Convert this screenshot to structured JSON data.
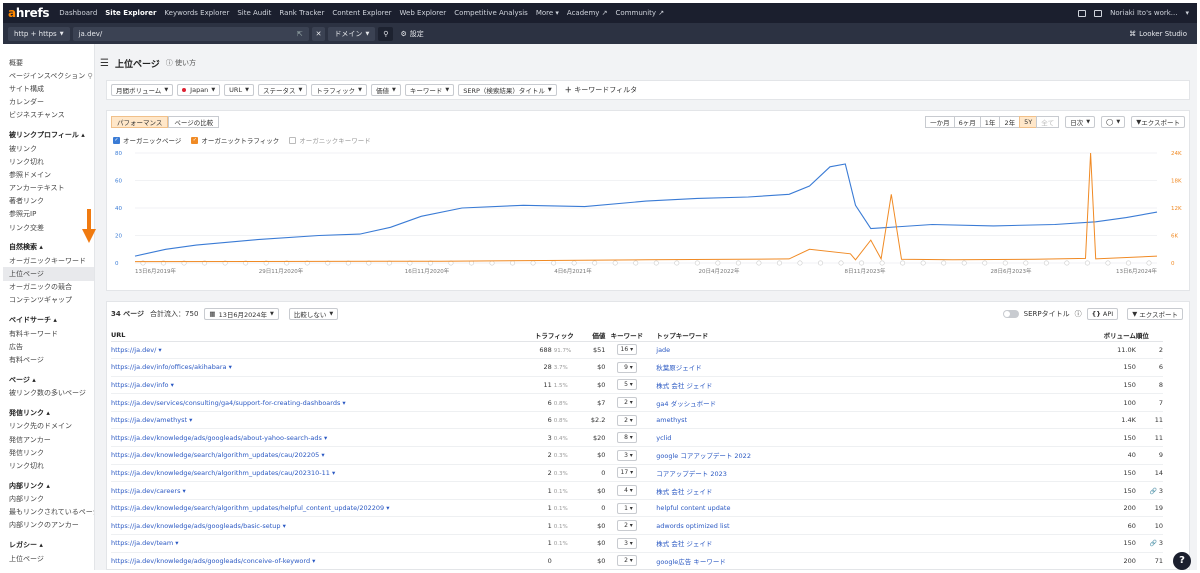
{
  "nav": {
    "logo_a": "a",
    "logo_rest": "hrefs",
    "items": [
      "Dashboard",
      "Site Explorer",
      "Keywords Explorer",
      "Site Audit",
      "Rank Tracker",
      "Content Explorer",
      "Web Explorer",
      "Competitive Analysis",
      "More ▾",
      "Academy ↗",
      "Community ↗"
    ],
    "user": "Noriaki Ito's work..."
  },
  "urlbar": {
    "protocol": "http + https",
    "url": "ja.dev/",
    "mode": "ドメイン",
    "settings": "設定",
    "looker": "Looker Studio"
  },
  "sidebar": [
    {
      "head": "",
      "items": [
        "概要",
        "ページインスペクション",
        "サイト構成",
        "カレンダー",
        "ビジネスチャンス"
      ]
    },
    {
      "head": "被リンクプロフィール ▴",
      "items": [
        "被リンク",
        "リンク切れ",
        "参照ドメイン",
        "アンカーテキスト",
        "著者リンク",
        "参照元IP",
        "リンク交差"
      ]
    },
    {
      "head": "自然検索 ▴",
      "items": [
        "オーガニックキーワード",
        "上位ページ",
        "オーガニックの競合",
        "コンテンツギャップ"
      ]
    },
    {
      "head": "ペイドサーチ ▴",
      "items": [
        "有料キーワード",
        "広告",
        "有料ページ"
      ]
    },
    {
      "head": "ページ ▴",
      "items": [
        "被リンク数の多いページ"
      ]
    },
    {
      "head": "発信リンク ▴",
      "items": [
        "リンク先のドメイン",
        "発信アンカー",
        "発信リンク",
        "リンク切れ"
      ]
    },
    {
      "head": "内部リンク ▴",
      "items": [
        "内部リンク",
        "最もリンクされているページ",
        "内部リンクのアンカー"
      ]
    },
    {
      "head": "レガシー ▴",
      "items": [
        "上位ページ"
      ]
    }
  ],
  "page": {
    "title": "上位ページ",
    "help": "使い方"
  },
  "filters": [
    "月間ボリューム",
    "Japan",
    "URL",
    "ステータス",
    "トラフィック",
    "価値",
    "キーワード",
    "SERP（検索結果）タイトル"
  ],
  "kw_filter": "キーワードフィルタ",
  "chart_controls": {
    "tabs": [
      "パフォーマンス",
      "ページの比較"
    ],
    "periods": [
      "一か月",
      "6ヶ月",
      "1年",
      "2年",
      "5Y",
      "全て"
    ],
    "active_period": "5Y",
    "interval": "日次",
    "export": "エクスポート",
    "legend": [
      "オーガニックページ",
      "オーガニックトラフィック",
      "オーガニックキーワード"
    ]
  },
  "chart_data": {
    "type": "line",
    "x_labels": [
      "13日6月2019年",
      "29日11月2020年",
      "16日11月2020年",
      "4日6月2021年",
      "20日4月2022年",
      "8日11月2023年",
      "28日6月2023年",
      "13日6月2024年"
    ],
    "left_ticks": [
      "0",
      "20",
      "40",
      "60",
      "80"
    ],
    "right_ticks": [
      "0",
      "6K",
      "12K",
      "18K",
      "24K"
    ],
    "ylim_left": [
      0,
      80
    ],
    "ylim_right": [
      0,
      24000
    ],
    "series": [
      {
        "name": "オーガニックページ",
        "color": "#3a7bd5",
        "x": [
          0,
          0.03,
          0.06,
          0.12,
          0.18,
          0.22,
          0.25,
          0.28,
          0.32,
          0.38,
          0.44,
          0.5,
          0.55,
          0.6,
          0.64,
          0.66,
          0.68,
          0.695,
          0.705,
          0.72,
          0.78,
          0.84,
          0.9,
          0.94,
          0.97,
          1.0
        ],
        "values": [
          5,
          10,
          13,
          17,
          20,
          21,
          26,
          34,
          40,
          42,
          41,
          45,
          47,
          48,
          50,
          56,
          70,
          72,
          42,
          25,
          28,
          27,
          28,
          30,
          33,
          37
        ]
      },
      {
        "name": "オーガニックトラフィック",
        "color": "#f08a24",
        "x": [
          0,
          0.3,
          0.5,
          0.64,
          0.66,
          0.7,
          0.705,
          0.72,
          0.73,
          0.74,
          0.75,
          0.8,
          0.88,
          0.93,
          0.935,
          0.94,
          1.0
        ],
        "values": [
          300,
          400,
          700,
          900,
          3000,
          2000,
          700,
          5000,
          900,
          15000,
          800,
          700,
          800,
          1000,
          24000,
          900,
          1500
        ]
      }
    ]
  },
  "table_header": {
    "pages_count": "34 ページ",
    "total_traffic": "合計流入：750",
    "date": "13日6月2024年",
    "compare": "比較しない",
    "serp_toggle": "SERPタイトル",
    "api": "API",
    "export": "エクスポート"
  },
  "columns": [
    "URL",
    "トラフィック",
    "価値",
    "キーワード",
    "トップキーワード",
    "ボリューム",
    "順位"
  ],
  "rows": [
    {
      "url": "https://ja.dev/",
      "traffic": "688",
      "pct": "91.7%",
      "value": "$51",
      "kws": "16",
      "topkw": "jade",
      "vol": "11.0K",
      "pos": "2",
      "link": false
    },
    {
      "url": "https://ja.dev/info/offices/akihabara",
      "traffic": "28",
      "pct": "3.7%",
      "value": "$0",
      "kws": "9",
      "topkw": "秋葉原ジェイド",
      "vol": "150",
      "pos": "6",
      "link": false
    },
    {
      "url": "https://ja.dev/info",
      "traffic": "11",
      "pct": "1.5%",
      "value": "$0",
      "kws": "5",
      "topkw": "株式 会社 ジェイド",
      "vol": "150",
      "pos": "8",
      "link": false
    },
    {
      "url": "https://ja.dev/services/consulting/ga4/support-for-creating-dashboards",
      "traffic": "6",
      "pct": "0.8%",
      "value": "$7",
      "kws": "2",
      "topkw": "ga4 ダッシュボード",
      "vol": "100",
      "pos": "7",
      "link": false
    },
    {
      "url": "https://ja.dev/amethyst",
      "traffic": "6",
      "pct": "0.8%",
      "value": "$2.2",
      "kws": "2",
      "topkw": "amethyst",
      "vol": "1.4K",
      "pos": "11",
      "link": false
    },
    {
      "url": "https://ja.dev/knowledge/ads/googleads/about-yahoo-search-ads",
      "traffic": "3",
      "pct": "0.4%",
      "value": "$20",
      "kws": "8",
      "topkw": "yclid",
      "vol": "150",
      "pos": "11",
      "link": false
    },
    {
      "url": "https://ja.dev/knowledge/search/algorithm_updates/cau/202205",
      "traffic": "2",
      "pct": "0.3%",
      "value": "$0",
      "kws": "3",
      "topkw": "google コアアップデート 2022",
      "vol": "40",
      "pos": "9",
      "link": false
    },
    {
      "url": "https://ja.dev/knowledge/search/algorithm_updates/cau/202310-11",
      "traffic": "2",
      "pct": "0.3%",
      "value": "0",
      "kws": "17",
      "topkw": "コアアップデート 2023",
      "vol": "150",
      "pos": "14",
      "link": false
    },
    {
      "url": "https://ja.dev/careers",
      "traffic": "1",
      "pct": "0.1%",
      "value": "$0",
      "kws": "4",
      "topkw": "株式 会社 ジェイド",
      "vol": "150",
      "pos": "3",
      "link": true
    },
    {
      "url": "https://ja.dev/knowledge/search/algorithm_updates/helpful_content_update/202209",
      "traffic": "1",
      "pct": "0.1%",
      "value": "0",
      "kws": "1",
      "topkw": "helpful content update",
      "vol": "200",
      "pos": "19",
      "link": false
    },
    {
      "url": "https://ja.dev/knowledge/ads/googleads/basic-setup",
      "traffic": "1",
      "pct": "0.1%",
      "value": "$0",
      "kws": "2",
      "topkw": "adwords optimized list",
      "vol": "60",
      "pos": "10",
      "link": false
    },
    {
      "url": "https://ja.dev/team",
      "traffic": "1",
      "pct": "0.1%",
      "value": "$0",
      "kws": "3",
      "topkw": "株式 会社 ジェイド",
      "vol": "150",
      "pos": "3",
      "link": true
    },
    {
      "url": "https://ja.dev/knowledge/ads/googleads/conceive-of-keyword",
      "traffic": "0",
      "pct": "",
      "value": "$0",
      "kws": "2",
      "topkw": "google広告 キーワード",
      "vol": "200",
      "pos": "71",
      "link": false
    }
  ]
}
